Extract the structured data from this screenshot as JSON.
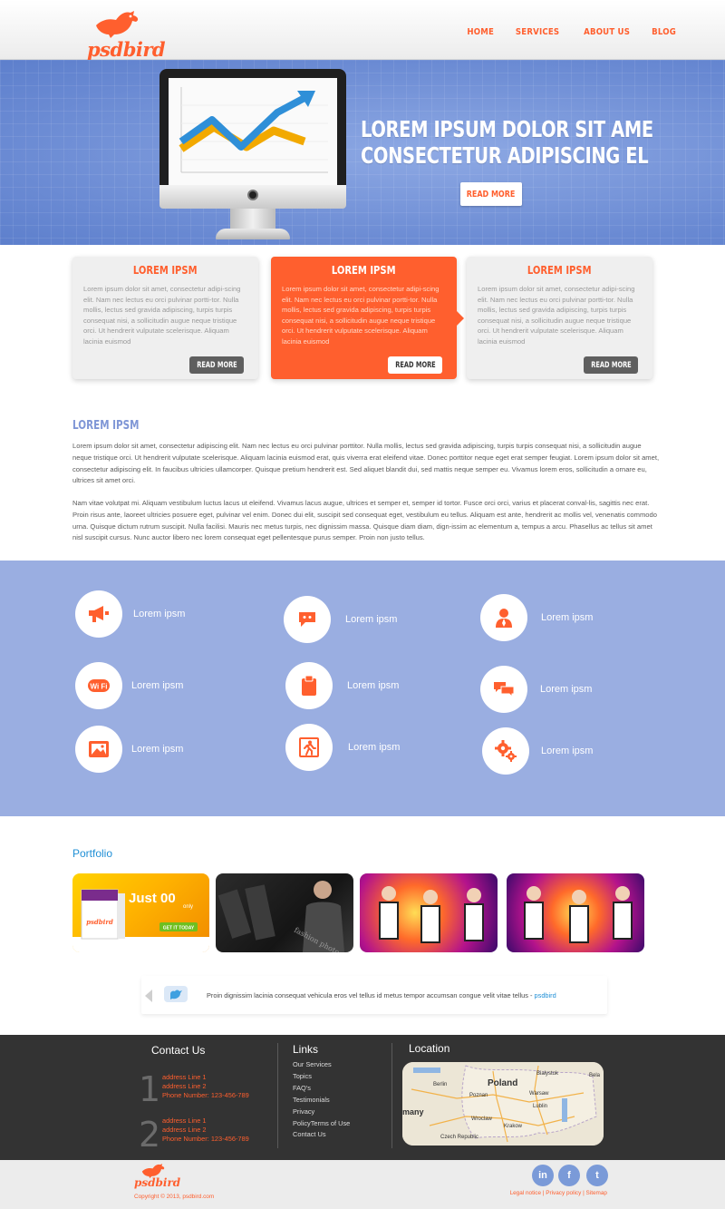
{
  "brand": {
    "name": "psdbird",
    "accent": "#ff5f2e",
    "hero_blue": "#6c8fd6",
    "services_blue": "#9aaee1"
  },
  "nav": [
    {
      "label": "HOME"
    },
    {
      "label": "SERVICES"
    },
    {
      "label": "ABOUT US"
    },
    {
      "label": "BLOG"
    }
  ],
  "hero": {
    "line1": "LOREM IPSUM DOLOR SIT AME",
    "line2": "CONSECTETUR ADIPISCING EL",
    "button": "READ MORE",
    "image_icon": "monitor-chart-icon"
  },
  "boxes": [
    {
      "title": "LOREM IPSM",
      "text": "Lorem ipsum dolor sit amet, consectetur adipi-scing elit. Nam nec lectus eu orci pulvinar portti-tor. Nulla mollis, lectus sed gravida adipiscing, turpis turpis consequat nisi, a sollicitudin augue neque tristique orci. Ut hendrerit vulputate scelerisque. Aliquam lacinia euismod",
      "button": "READ MORE"
    },
    {
      "title": "LOREM IPSM",
      "text": "Lorem ipsum dolor sit amet, consectetur adipi-scing elit. Nam nec lectus eu orci pulvinar portti-tor. Nulla mollis, lectus sed gravida adipiscing, turpis turpis consequat nisi, a sollicitudin augue neque tristique orci. Ut hendrerit vulputate scelerisque. Aliquam lacinia euismod",
      "button": "READ MORE"
    },
    {
      "title": "LOREM IPSM",
      "text": "Lorem ipsum dolor sit amet, consectetur adipi-scing elit. Nam nec lectus eu orci pulvinar portti-tor. Nulla mollis, lectus sed gravida adipiscing, turpis turpis consequat nisi, a sollicitudin augue neque tristique orci. Ut hendrerit vulputate scelerisque. Aliquam lacinia euismod",
      "button": "READ MORE"
    }
  ],
  "about": {
    "title": "LOREM IPSM",
    "p1": "Lorem ipsum dolor sit amet, consectetur adipiscing elit. Nam nec lectus eu orci pulvinar porttitor. Nulla mollis, lectus sed gravida adipiscing, turpis turpis consequat nisi, a sollicitudin augue neque tristique orci. Ut hendrerit vulputate scelerisque. Aliquam lacinia euismod erat, quis viverra erat eleifend vitae. Donec porttitor neque eget erat semper feugiat. Lorem ipsum dolor sit amet, consectetur adipiscing elit. In faucibus ultricies ullamcorper. Quisque pretium hendrerit est. Sed aliquet blandit dui, sed mattis neque semper eu. Vivamus lorem eros, sollicitudin a ornare eu, ultrices sit amet orci.",
    "p2": "Nam vitae volutpat mi. Aliquam vestibulum luctus lacus ut eleifend. Vivamus lacus augue, ultrices et semper et, semper id tortor. Fusce orci orci, varius et placerat conval-lis, sagittis nec erat. Proin risus ante, laoreet ultricies posuere eget, pulvinar vel enim. Donec dui elit, suscipit sed consequat eget, vestibulum eu tellus. Aliquam est ante, hendrerit ac mollis vel, venenatis commodo urna. Quisque dictum rutrum suscipit. Nulla facilisi. Mauris nec metus turpis, nec dignissim massa. Quisque diam diam, dign-issim ac elementum a, tempus a arcu. Phasellus ac tellus sit amet nisl suscipit cursus. Nunc auctor libero nec lorem consequat eget pellentesque purus semper. Proin non justo tellus."
  },
  "services": [
    {
      "label": "Lorem ipsm",
      "icon": "megaphone-icon"
    },
    {
      "label": "Lorem ipsm",
      "icon": "chat-bubble-icon"
    },
    {
      "label": "Lorem ipsm",
      "icon": "person-icon"
    },
    {
      "label": "Lorem ipsm",
      "icon": "wifi-icon"
    },
    {
      "label": "Lorem ipsm",
      "icon": "clipboard-icon"
    },
    {
      "label": "Lorem ipsm",
      "icon": "speech-bubbles-icon"
    },
    {
      "label": "Lorem ipsm",
      "icon": "picture-icon"
    },
    {
      "label": "Lorem ipsm",
      "icon": "exit-sign-icon"
    },
    {
      "label": "Lorem ipsm",
      "icon": "gears-icon"
    }
  ],
  "portfolio": {
    "title": "Portfolio",
    "items": [
      {
        "caption": "Just 00",
        "sub": "only",
        "brand": "psdbird",
        "cta": "GET IT TODAY"
      },
      {
        "caption": "fashion photography"
      },
      {
        "caption": ""
      },
      {
        "caption": ""
      }
    ]
  },
  "tweet": {
    "text": "Proin dignissim lacinia consequat vehicula eros vel tellus id metus tempor accumsan congue velit vitae tellus",
    "separator": " - ",
    "link": "psdbird"
  },
  "footer": {
    "contact_title": "Contact Us",
    "contacts": [
      {
        "num": "1",
        "line1": "address Line 1",
        "line2": "address Line 2",
        "phone": "Phone Number: 123-456-789"
      },
      {
        "num": "2",
        "line1": "address Line 1",
        "line2": "address Line 2",
        "phone": "Phone Number: 123-456-789"
      }
    ],
    "links_title": "Links",
    "links": [
      "Our Services",
      "Topics",
      "FAQ's",
      "Testimonials",
      "Privacy",
      "PolicyTerms of Use",
      "Contact Us"
    ],
    "location_title": "Location",
    "map_labels": [
      "Białystok",
      "Bela",
      "Berlin",
      "Poland",
      "Poznan",
      "Warsaw",
      "many",
      "Wroclaw",
      "Lublin",
      "Krakow",
      "Czech Republic"
    ]
  },
  "bottom": {
    "logo": "psdbird",
    "copyright": "Copyright © 2013, psdbird.com",
    "social": [
      {
        "label": "in",
        "icon": "linkedin-icon"
      },
      {
        "label": "f",
        "icon": "facebook-icon"
      },
      {
        "label": "t",
        "icon": "twitter-icon"
      }
    ],
    "legal": [
      "Legal notice",
      "Privacy policy",
      "Sitemap"
    ],
    "legal_sep": " | "
  }
}
